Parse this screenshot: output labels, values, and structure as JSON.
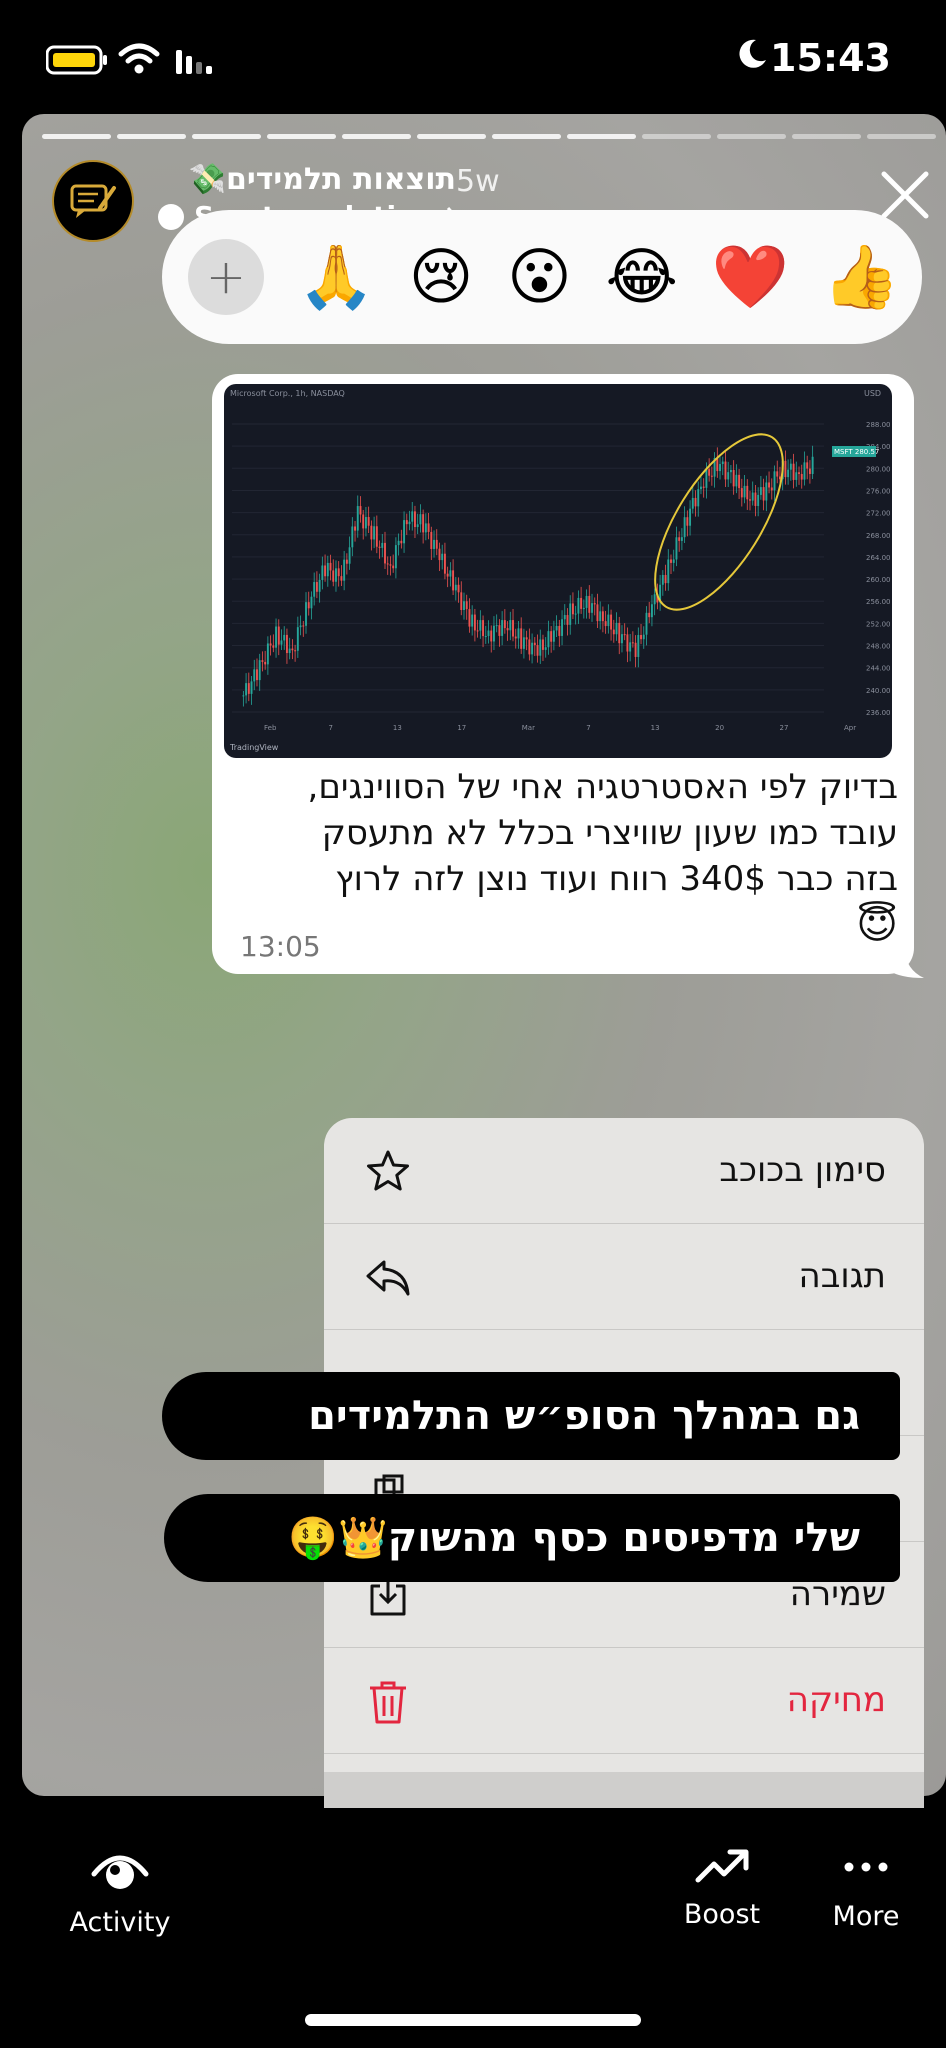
{
  "status_bar": {
    "time": "15:43"
  },
  "story": {
    "username": "תוצאות תלמידים",
    "username_emoji": "💸",
    "time_ago": "5w",
    "see_translation": "See translation"
  },
  "reactions": [
    "🙏",
    "😢",
    "😮",
    "😂",
    "❤️",
    "👍"
  ],
  "message": {
    "lines": [
      "בדיוק לפי האסטרטגיה אחי של הסווינגים,",
      "עובד כמו שעון שוויצרי בכלל לא מתעסק",
      "בזה כבר 340$ רווח ועוד נוצן לזה לרוץ"
    ],
    "emoji": "😇",
    "time": "13:05"
  },
  "chart_data": {
    "type": "candlestick",
    "title": "Microsoft Corp., 1h, NASDAQ",
    "currency": "USD",
    "price_tag": "MSFT 280.57",
    "y_ticks": [
      236.0,
      240.0,
      244.0,
      248.0,
      252.0,
      256.0,
      260.0,
      264.0,
      268.0,
      272.0,
      276.0,
      280.0,
      284.0,
      288.0
    ],
    "x_ticks": [
      "Feb",
      "7",
      "13",
      "17",
      "Mar",
      "7",
      "13",
      "20",
      "27",
      "Apr"
    ],
    "brand": "TradingView",
    "series": [
      {
        "name": "MSFT",
        "close": [
          239,
          244,
          250,
          247,
          256,
          262,
          260,
          272,
          268,
          262,
          271,
          270,
          264,
          258,
          252,
          250,
          252,
          249,
          247,
          250,
          254,
          256,
          253,
          250,
          247,
          255,
          262,
          270,
          277,
          281,
          278,
          274,
          276,
          280,
          279,
          281
        ]
      }
    ]
  },
  "menu": {
    "items": [
      {
        "label": "סימון בכוכב",
        "icon": "star-icon"
      },
      {
        "label": "תגובה",
        "icon": "reply-icon"
      },
      {
        "label": "",
        "icon": "forward-icon"
      },
      {
        "label": "",
        "icon": "copy-icon"
      },
      {
        "label": "שמירה",
        "icon": "save-icon"
      },
      {
        "label": "מחיקה",
        "icon": "trash-icon",
        "color": "#e3263f"
      }
    ]
  },
  "captions": {
    "line1": "גם במהלך הסופ״ש התלמידים",
    "line2": "שלי מדפיסים כסף מהשוק👑🤑"
  },
  "bottom_nav": {
    "activity": "Activity",
    "boost": "Boost",
    "more": "More"
  }
}
